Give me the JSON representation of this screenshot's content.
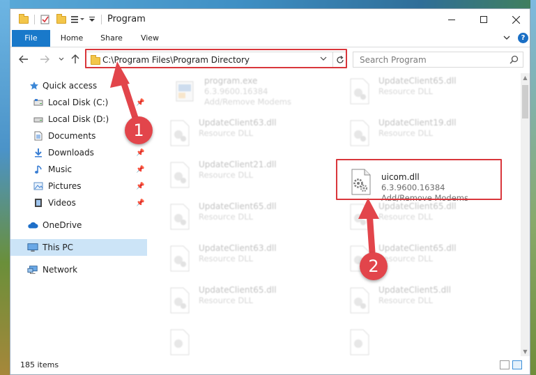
{
  "window": {
    "title": "Program",
    "controls": {
      "minimize": "—",
      "maximize": "☐",
      "close": "✕"
    }
  },
  "ribbon": {
    "tabs": [
      {
        "label": "File"
      },
      {
        "label": "Home"
      },
      {
        "label": "Share"
      },
      {
        "label": "View"
      }
    ],
    "help": "?"
  },
  "address_bar": {
    "path": "C:\\Program Files\\Program Directory"
  },
  "search": {
    "placeholder": "Search Program"
  },
  "sidebar": {
    "items": [
      {
        "label": "Quick access",
        "icon": "star-icon",
        "pinned": false
      },
      {
        "label": "Local Disk (C:)",
        "icon": "drive-icon",
        "pinned": true
      },
      {
        "label": "Local Disk (D:)",
        "icon": "drive-icon",
        "pinned": false
      },
      {
        "label": "Documents",
        "icon": "documents-icon",
        "pinned": true
      },
      {
        "label": "Downloads",
        "icon": "download-icon",
        "pinned": true
      },
      {
        "label": "Music",
        "icon": "music-icon",
        "pinned": true
      },
      {
        "label": "Pictures",
        "icon": "pictures-icon",
        "pinned": true
      },
      {
        "label": "Videos",
        "icon": "videos-icon",
        "pinned": true
      },
      {
        "label": "OneDrive",
        "icon": "cloud-icon",
        "pinned": false
      },
      {
        "label": "This PC",
        "icon": "computer-icon",
        "pinned": false,
        "selected": true
      },
      {
        "label": "Network",
        "icon": "network-icon",
        "pinned": false
      }
    ]
  },
  "files": [
    {
      "name": "program.exe",
      "line2": "6.3.9600.16384",
      "line3": "Add/Remove Modems",
      "faded": true
    },
    {
      "name": "UpdateClient65.dll",
      "line2": "Resource DLL",
      "faded": true
    },
    {
      "name": "UpdateClient63.dll",
      "line2": "Resource DLL",
      "faded": true
    },
    {
      "name": "UpdateClient19.dll",
      "line2": "Resource DLL",
      "faded": true
    },
    {
      "name": "UpdateClient21.dll",
      "line2": "Resource DLL",
      "faded": true
    },
    {
      "name": "uicom.dll",
      "line2": "6.3.9600.16384",
      "line3": "Add/Remove Modems",
      "faded": false
    },
    {
      "name": "UpdateClient65.dll",
      "line2": "Resource DLL",
      "faded": true
    },
    {
      "name": "UpdateClient65.dll",
      "line2": "Resource DLL",
      "faded": true
    },
    {
      "name": "UpdateClient63.dll",
      "line2": "Resource DLL",
      "faded": true
    },
    {
      "name": "UpdateClient65.dll",
      "line2": "Resource DLL",
      "faded": true
    },
    {
      "name": "UpdateClient65.dll",
      "line2": "Resource DLL",
      "faded": true
    },
    {
      "name": "UpdateClient5.dll",
      "line2": "Resource DLL",
      "faded": true
    }
  ],
  "status": {
    "item_count": "185 items"
  },
  "callouts": [
    {
      "number": "1"
    },
    {
      "number": "2"
    }
  ],
  "colors": {
    "accent": "#1979ca",
    "annotation": "#d9363b",
    "selection": "#cce4f7"
  }
}
